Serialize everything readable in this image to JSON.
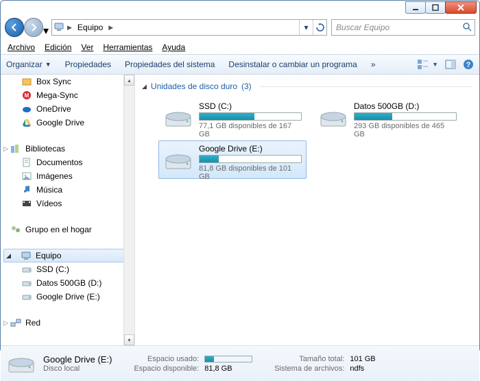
{
  "address": {
    "location": "Equipo"
  },
  "search": {
    "placeholder": "Buscar Equipo"
  },
  "menu": {
    "file": "Archivo",
    "edit": "Edición",
    "view": "Ver",
    "tools": "Herramientas",
    "help": "Ayuda"
  },
  "toolbar": {
    "organize": "Organizar",
    "properties": "Propiedades",
    "sysprops": "Propiedades del sistema",
    "uninstall": "Desinstalar o cambiar un programa",
    "overflow": "»"
  },
  "sidebar": {
    "favorites": [
      {
        "label": "Box Sync",
        "icon": "box"
      },
      {
        "label": "Mega-Sync",
        "icon": "mega"
      },
      {
        "label": "OneDrive",
        "icon": "onedrive"
      },
      {
        "label": "Google Drive",
        "icon": "gdrive"
      }
    ],
    "libraries_label": "Bibliotecas",
    "libraries": [
      {
        "label": "Documentos"
      },
      {
        "label": "Imágenes"
      },
      {
        "label": "Música"
      },
      {
        "label": "Vídeos"
      }
    ],
    "homegroup": "Grupo en el hogar",
    "computer": "Equipo",
    "drives": [
      {
        "label": "SSD (C:)"
      },
      {
        "label": "Datos 500GB (D:)"
      },
      {
        "label": "Google Drive (E:)"
      }
    ],
    "network": "Red"
  },
  "group": {
    "title": "Unidades de disco duro",
    "count": "(3)"
  },
  "drives": [
    {
      "name": "SSD  (C:)",
      "sub": "77,1 GB disponibles de 167 GB",
      "fill": 54
    },
    {
      "name": "Datos 500GB (D:)",
      "sub": "293 GB disponibles de 465 GB",
      "fill": 37
    },
    {
      "name": "Google Drive (E:)",
      "sub": "81,8 GB disponibles de 101 GB",
      "fill": 19
    }
  ],
  "details": {
    "title": "Google Drive (E:)",
    "subtitle": "Disco local",
    "used_label": "Espacio usado:",
    "used_fill": 19,
    "free_label": "Espacio disponible:",
    "free_val": "81,8 GB",
    "total_label": "Tamaño total:",
    "total_val": "101 GB",
    "fs_label": "Sistema de archivos:",
    "fs_val": "ndfs"
  }
}
